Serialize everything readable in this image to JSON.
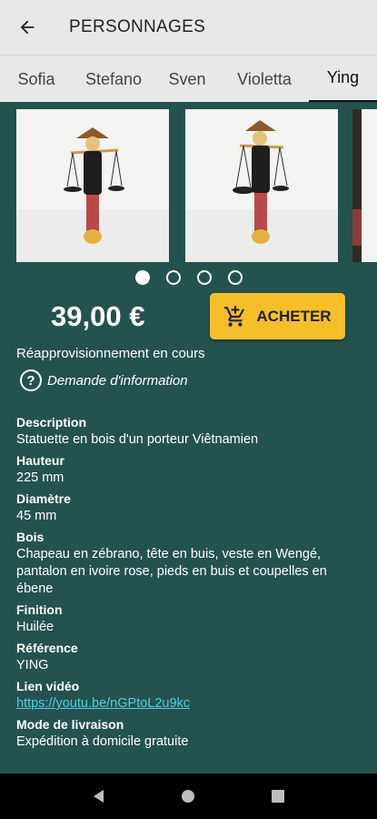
{
  "appbar": {
    "title": "PERSONNAGES"
  },
  "tabs": [
    {
      "label": "Sofia"
    },
    {
      "label": "Stefano"
    },
    {
      "label": "Sven"
    },
    {
      "label": "Violetta"
    },
    {
      "label": "Ying"
    }
  ],
  "gallery": {
    "page_count": 4,
    "current_index": 0
  },
  "product": {
    "price": "39,00 €",
    "buy_label": "ACHETER",
    "stock": "Réapprovisionnement en cours",
    "info_label": "Demande d'information"
  },
  "details": [
    {
      "label": "Description",
      "value": "Statuette en bois d'un porteur Viêtnamien"
    },
    {
      "label": "Hauteur",
      "value": "225 mm"
    },
    {
      "label": "Diamètre",
      "value": "45 mm"
    },
    {
      "label": "Bois",
      "value": "Chapeau en zébrano, tête en buis, veste en Wengé, pantalon en ivoire rose, pieds en buis et coupelles en ébene"
    },
    {
      "label": "Finition",
      "value": "Huilée"
    },
    {
      "label": "Référence",
      "value": "YING"
    },
    {
      "label": "Lien vidéo",
      "value": "https://youtu.be/nGPtoL2u9kc"
    },
    {
      "label": "Mode de livraison",
      "value": "Expédition à domicile gratuite"
    }
  ],
  "colors": {
    "background": "#24524f",
    "accent": "#f5bf2a",
    "link": "#4dd0e1"
  },
  "icons": {
    "back": "arrow-left-icon",
    "cart": "add-shopping-cart-icon",
    "info": "help-circle-icon"
  }
}
